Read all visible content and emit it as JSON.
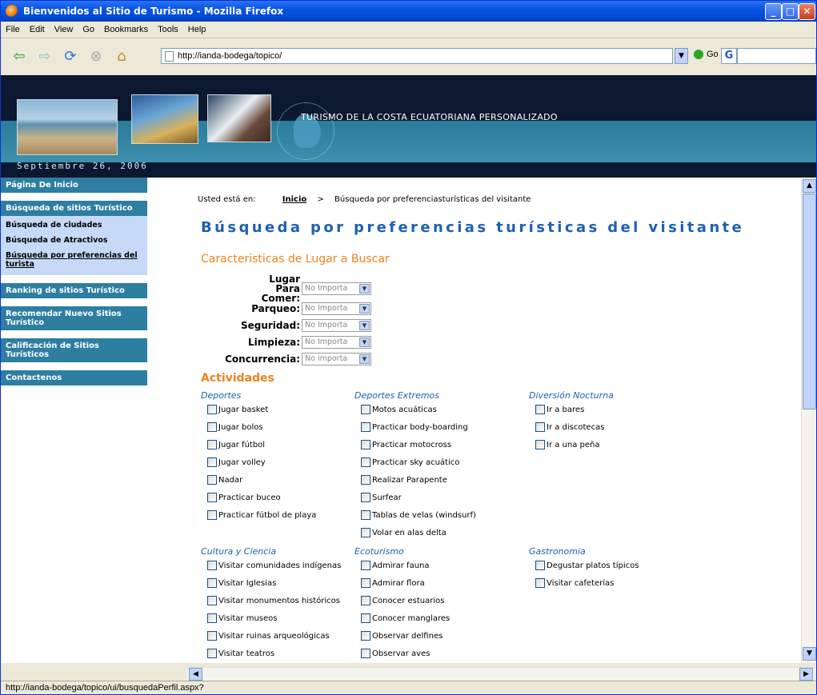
{
  "window": {
    "title": "Bienvenidos al Sitio de Turismo - Mozilla Firefox"
  },
  "menu": [
    "File",
    "Edit",
    "View",
    "Go",
    "Bookmarks",
    "Tools",
    "Help"
  ],
  "toolbar": {
    "url": "http://ianda-bodega/topico/",
    "go_label": "Go"
  },
  "banner": {
    "title_prefix": "T",
    "title_rest": "URISMO DE LA ",
    "title": "Turismo de la Costa Ecuatoriana Personalizado",
    "date": "Septiembre 26, 2006"
  },
  "sidebar": {
    "home": "Página De Inicio",
    "search": "Búsqueda de sitios Turístico",
    "sub": [
      "Búsqueda de ciudades",
      "Búsqueda de Atractivos",
      "Búsqueda por preferencias del turista"
    ],
    "ranking": "Ranking de sitios Turístico",
    "recommend": "Recomendar Nuevo Sitios Turístico",
    "rating": "Calificación de Sitios Turísticos",
    "contact": "Contactenos"
  },
  "breadcrumb": {
    "prefix": "Usted está en:",
    "home": "Inicio",
    "sep": ">",
    "current": "Búsqueda por preferenciasturísticas del visitante"
  },
  "heading": "Búsqueda por preferencias turísticas del visitante",
  "subheading": "Caracteristicas de Lugar a Buscar",
  "form": [
    {
      "label": "Lugar Para Comer:",
      "value": "No Importa"
    },
    {
      "label": "Parqueo:",
      "value": "No Importa"
    },
    {
      "label": "Seguridad:",
      "value": "No Importa"
    },
    {
      "label": "Limpieza:",
      "value": "No Importa"
    },
    {
      "label": "Concurrencia:",
      "value": "No importa"
    }
  ],
  "activities_title": "Actividades",
  "categories": {
    "deportes": {
      "title": "Deportes",
      "items": [
        "Jugar basket",
        "Jugar bolos",
        "Jugar fútbol",
        "Jugar volley",
        "Nadar",
        "Practicar buceo",
        "Practicar fútbol de playa"
      ]
    },
    "extremos": {
      "title": "Deportes Extremos",
      "items": [
        "Motos acuáticas",
        "Practicar body-boarding",
        "Practicar motocross",
        "Practicar sky acuático",
        "Realizar Parapente",
        "Surfear",
        "Tablas de velas (windsurf)",
        "Volar en alas delta"
      ]
    },
    "nocturna": {
      "title": "Diversión Nocturna",
      "items": [
        "Ir a bares",
        "Ir a discotecas",
        "Ir a una peña"
      ]
    },
    "cultura": {
      "title": "Cultura y Ciencia",
      "items": [
        "Visitar comunidades indígenas",
        "Visitar Iglesias",
        "Visitar monumentos históricos",
        "Visitar museos",
        "Visitar ruinas arqueológicas",
        "Visitar teatros"
      ]
    },
    "eco": {
      "title": "Ecoturismo",
      "items": [
        "Admirar fauna",
        "Admirar flora",
        "Conocer estuarios",
        "Conocer manglares",
        "Observar delfines",
        "Observar aves"
      ]
    },
    "gastro": {
      "title": "Gastronomia",
      "items": [
        "Degustar platos típicos",
        "Visitar cafeterías"
      ]
    }
  },
  "status": "http://ianda-bodega/topico/ui/busquedaPerfil.aspx?"
}
